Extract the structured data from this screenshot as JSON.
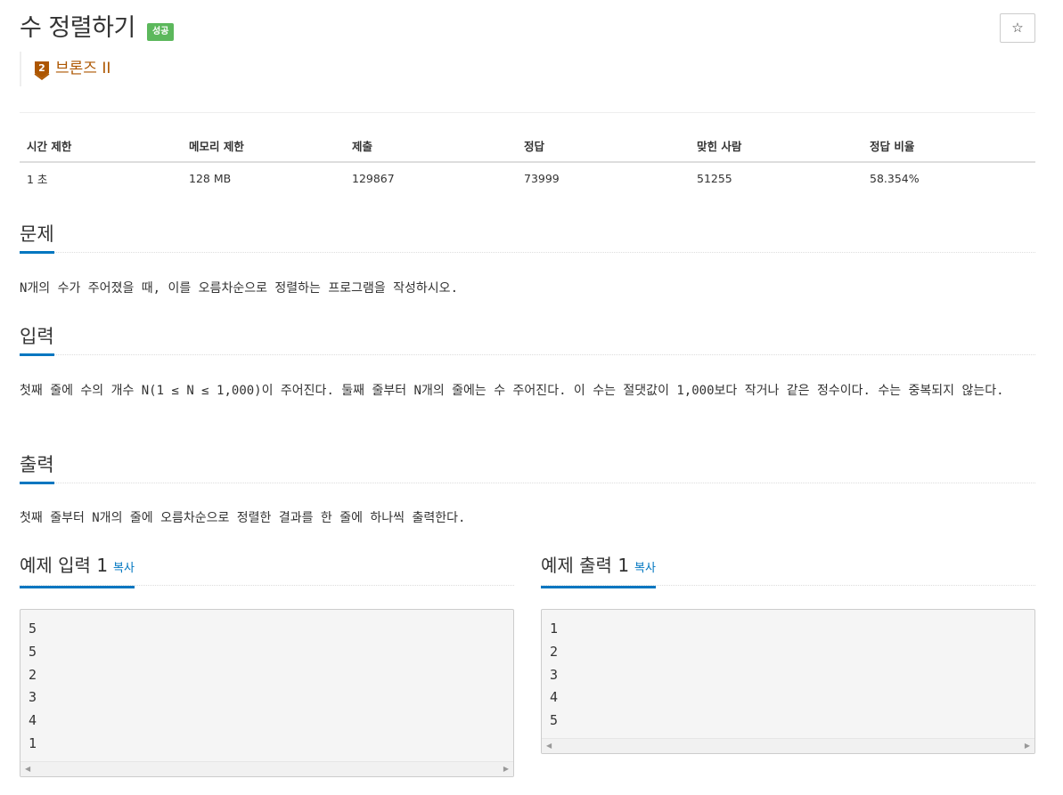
{
  "problem": {
    "title": "수 정렬하기",
    "status_badge": "성공",
    "star_icon": "☆",
    "tier": {
      "icon_number": "2",
      "label": "브론즈 II",
      "color": "#ad5600"
    }
  },
  "info_table": {
    "headers": [
      "시간 제한",
      "메모리 제한",
      "제출",
      "정답",
      "맞힌 사람",
      "정답 비율"
    ],
    "values": [
      "1 초",
      "128 MB",
      "129867",
      "73999",
      "51255",
      "58.354%"
    ]
  },
  "sections": {
    "problem": {
      "title": "문제",
      "text": "N개의 수가 주어졌을 때, 이를 오름차순으로 정렬하는 프로그램을 작성하시오."
    },
    "input": {
      "title": "입력",
      "text": "첫째 줄에 수의 개수 N(1 ≤ N ≤ 1,000)이 주어진다. 둘째 줄부터 N개의 줄에는 수 주어진다. 이 수는 절댓값이 1,000보다 작거나 같은 정수이다. 수는 중복되지 않는다."
    },
    "output": {
      "title": "출력",
      "text": "첫째 줄부터 N개의 줄에 오름차순으로 정렬한 결과를 한 줄에 하나씩 출력한다."
    }
  },
  "samples": {
    "input": {
      "title": "예제 입력 1",
      "copy_label": "복사",
      "content": "5\n5\n2\n3\n4\n1"
    },
    "output": {
      "title": "예제 출력 1",
      "copy_label": "복사",
      "content": "1\n2\n3\n4\n5"
    }
  },
  "colors": {
    "accent": "#0076c0",
    "success": "#5cb85c"
  }
}
